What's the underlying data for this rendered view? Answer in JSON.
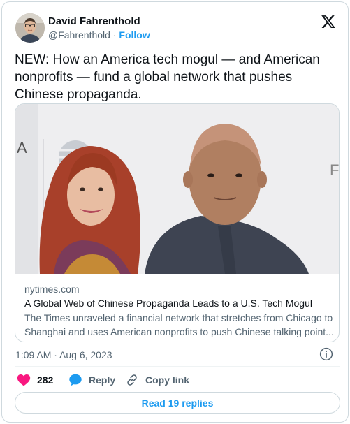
{
  "author": {
    "name": "David Fahrenthold",
    "handle": "@Fahrenthold",
    "separator": "·",
    "follow_label": "Follow"
  },
  "tweet": {
    "text": "NEW: How an America tech mogul — and American nonprofits — fund a global network that pushes Chinese propaganda.",
    "timestamp": "1:09 AM · Aug 6, 2023"
  },
  "link_card": {
    "domain": "nytimes.com",
    "title": "A Global Web of Chinese Propaganda Leads to a U.S. Tech Mogul",
    "description_line1": "The Times unraveled a financial network that stretches from Chicago to",
    "description_line2": "Shanghai and uses American nonprofits to push Chinese talking point..."
  },
  "actions": {
    "like_count": "282",
    "reply_label": "Reply",
    "copy_link_label": "Copy link"
  },
  "read_replies_label": "Read 19 replies",
  "colors": {
    "accent": "#1d9bf0",
    "like": "#f91880",
    "text_primary": "#0f1419",
    "text_secondary": "#536471",
    "border": "#cfd9de"
  },
  "icons": [
    "x-logo-icon",
    "info-icon",
    "heart-icon",
    "reply-bubble-icon",
    "link-icon"
  ]
}
